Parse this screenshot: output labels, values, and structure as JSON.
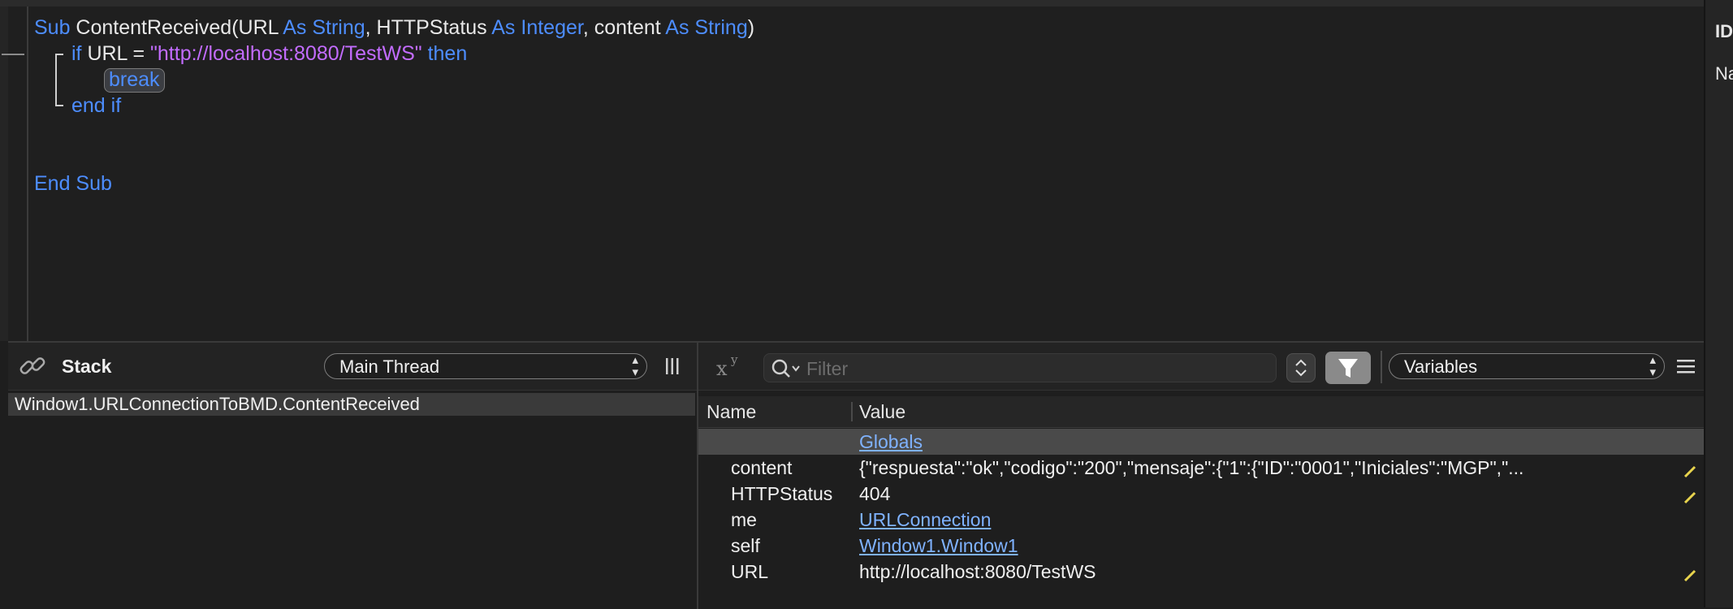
{
  "editor": {
    "lines": {
      "l1": {
        "kw_sub": "Sub",
        "name": " ContentReceived(URL ",
        "as1": "As String",
        "p2": ", HTTPStatus ",
        "as2": "As Integer",
        "p3": ", content ",
        "as3": "As String",
        "close": ")"
      },
      "l2": {
        "kw_if": "if",
        "mid": " URL = ",
        "str": "\"http://localhost:8080/TestWS\"",
        "kw_then": " then"
      },
      "l3": {
        "break": "break"
      },
      "l4": {
        "end_if": "end if"
      },
      "l5": {
        "end_sub": "End Sub"
      }
    }
  },
  "inspector": {
    "label1": "ID",
    "label2": "Na"
  },
  "stack_panel": {
    "title": "Stack",
    "thread_select": "Main Thread",
    "frames": [
      "Window1.URLConnectionToBMD.ContentReceived"
    ]
  },
  "variables_panel": {
    "filter_placeholder": "Filter",
    "view_select": "Variables",
    "columns": {
      "name": "Name",
      "value": "Value"
    },
    "globals_label": "Globals",
    "rows": [
      {
        "name": "content",
        "value": "{\"respuesta\":\"ok\",\"codigo\":\"200\",\"mensaje\":{\"1\":{\"ID\":\"0001\",\"Iniciales\":\"MGP\",\"...",
        "link": false,
        "editable": true
      },
      {
        "name": "HTTPStatus",
        "value": "404",
        "link": false,
        "editable": true
      },
      {
        "name": "me",
        "value": "URLConnection",
        "link": true,
        "editable": false
      },
      {
        "name": "self",
        "value": "Window1.Window1",
        "link": true,
        "editable": false
      },
      {
        "name": "URL",
        "value": "http://localhost:8080/TestWS",
        "link": false,
        "editable": true
      }
    ]
  },
  "colors": {
    "keyword": "#4d8dff",
    "string": "#c36cff",
    "link": "#7fb2ff",
    "pencil": "#e8d44d"
  }
}
